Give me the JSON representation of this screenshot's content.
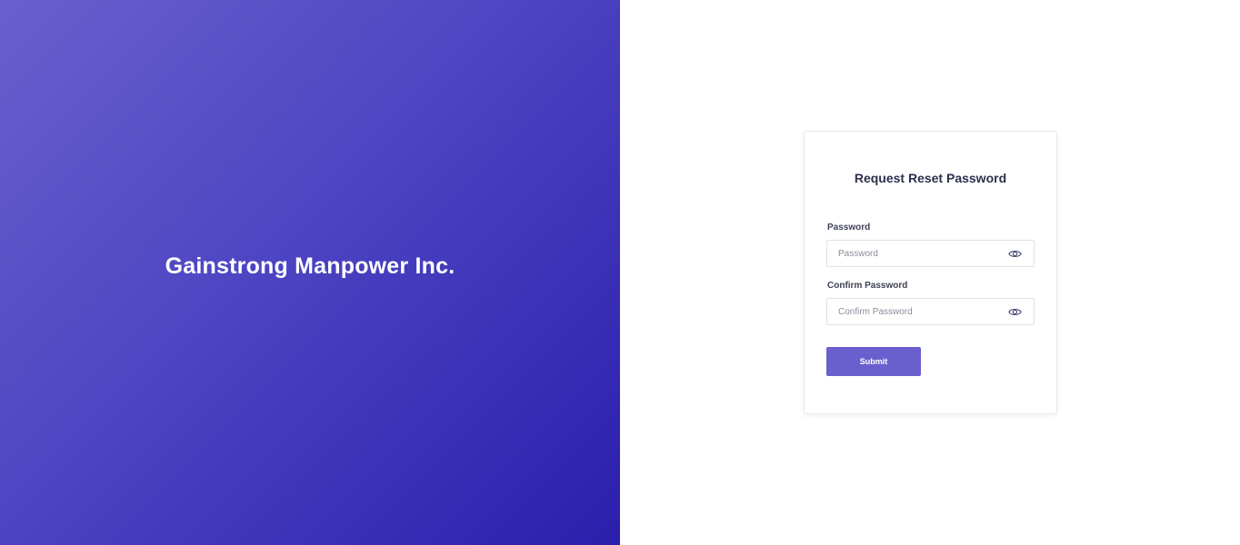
{
  "brand": {
    "name": "Gainstrong Manpower Inc."
  },
  "form": {
    "title": "Request Reset Password",
    "password": {
      "label": "Password",
      "placeholder": "Password",
      "value": "",
      "toggle_icon": "eye-icon"
    },
    "confirm_password": {
      "label": "Confirm Password",
      "placeholder": "Confirm Password",
      "value": "",
      "toggle_icon": "eye-icon"
    },
    "submit_label": "Submit"
  },
  "colors": {
    "gradient_start": "#6b5fcf",
    "gradient_end": "#2a1eac",
    "accent": "#6a5fcd",
    "title_text": "#2d2f4d"
  }
}
